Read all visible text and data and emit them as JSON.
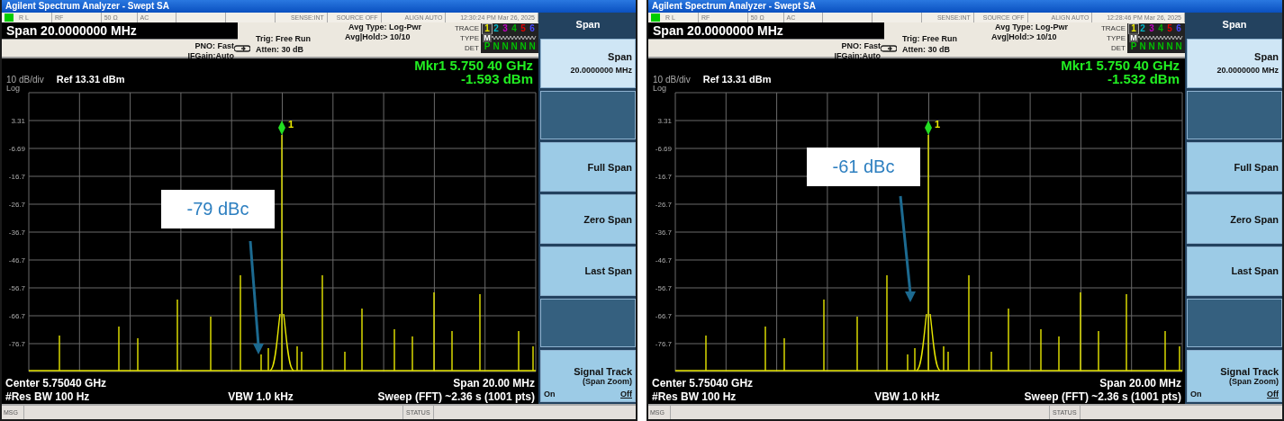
{
  "windows": [
    {
      "title": "Agilent Spectrum Analyzer - Swept SA",
      "status_items": [
        "R L",
        "RF",
        "50 Ω",
        "AC",
        "SENSE:INT",
        "SOURCE OFF",
        "ALIGN AUTO",
        "12:30:24 PM Mar 26, 2025"
      ],
      "active_function": "Span 20.0000000 MHz",
      "settings": {
        "pno": "PNO: Fast",
        "ifgain": "IFGain:Auto",
        "trig": "Trig: Free Run",
        "atten": "Atten: 30 dB",
        "avg_type": "Avg Type: Log-Pwr",
        "avg_hold": "Avg|Hold:> 10/10"
      },
      "trace_table": {
        "labels": [
          "TRACE",
          "TYPE",
          "DET"
        ],
        "traces": [
          {
            "number": "1",
            "color": "#e8e800",
            "selected": true,
            "type": "M",
            "det": "P"
          },
          {
            "number": "2",
            "color": "#00b8c8",
            "selected": false,
            "det": "N"
          },
          {
            "number": "3",
            "color": "#c000c0",
            "selected": false,
            "det": "N"
          },
          {
            "number": "4",
            "color": "#00b000",
            "selected": false,
            "det": "N"
          },
          {
            "number": "5",
            "color": "#e00000",
            "selected": false,
            "det": "N"
          },
          {
            "number": "6",
            "color": "#4848ff",
            "selected": false,
            "det": "N"
          }
        ]
      },
      "marker": {
        "frequency": "Mkr1 5.750 40 GHz",
        "amplitude": "-1.593 dBm",
        "label": "1"
      },
      "scale": "10 dB/div",
      "ref": "Ref 13.31 dBm",
      "scale_type": "Log",
      "y_labels": [
        "3.31",
        "-6.69",
        "-16.7",
        "-26.7",
        "-36.7",
        "-46.7",
        "-56.7",
        "-66.7",
        "-76.7"
      ],
      "annotation": "-79 dBc",
      "footer": {
        "center": "Center 5.75040 GHz",
        "span": "Span 20.00 MHz",
        "rbw": "#Res BW 100 Hz",
        "vbw": "VBW 1.0 kHz",
        "sweep": "Sweep (FFT)  ~2.36 s (1001 pts)"
      },
      "message_bar": {
        "msg": "MSG",
        "status": "STATUS"
      },
      "menu": {
        "title": "Span",
        "keys": [
          {
            "kind": "value",
            "label": "Span",
            "value": "20.0000000 MHz",
            "selected": true
          },
          {
            "kind": "empty"
          },
          {
            "kind": "plain",
            "label": "Full Span"
          },
          {
            "kind": "plain",
            "label": "Zero Span"
          },
          {
            "kind": "plain",
            "label": "Last Span"
          },
          {
            "kind": "empty"
          },
          {
            "kind": "toggle",
            "label": "Signal Track",
            "sublabel": "(Span Zoom)",
            "on_label": "On",
            "off_label": "Off",
            "on": false
          }
        ]
      }
    },
    {
      "title": "Agilent Spectrum Analyzer - Swept SA",
      "status_items": [
        "R L",
        "RF",
        "50 Ω",
        "AC",
        "SENSE:INT",
        "SOURCE OFF",
        "ALIGN AUTO",
        "12:28:46 PM Mar 26, 2025"
      ],
      "active_function": "Span 20.0000000 MHz",
      "settings": {
        "pno": "PNO: Fast",
        "ifgain": "IFGain:Auto",
        "trig": "Trig: Free Run",
        "atten": "Atten: 30 dB",
        "avg_type": "Avg Type: Log-Pwr",
        "avg_hold": "Avg|Hold:> 10/10"
      },
      "trace_table": {
        "labels": [
          "TRACE",
          "TYPE",
          "DET"
        ],
        "traces": [
          {
            "number": "1",
            "color": "#e8e800",
            "selected": true,
            "type": "M",
            "det": "P"
          },
          {
            "number": "2",
            "color": "#00b8c8",
            "selected": false,
            "det": "N"
          },
          {
            "number": "3",
            "color": "#c000c0",
            "selected": false,
            "det": "N"
          },
          {
            "number": "4",
            "color": "#00b000",
            "selected": false,
            "det": "N"
          },
          {
            "number": "5",
            "color": "#e00000",
            "selected": false,
            "det": "N"
          },
          {
            "number": "6",
            "color": "#4848ff",
            "selected": false,
            "det": "N"
          }
        ]
      },
      "marker": {
        "frequency": "Mkr1 5.750 40 GHz",
        "amplitude": "-1.532 dBm",
        "label": "1"
      },
      "scale": "10 dB/div",
      "ref": "Ref 13.31 dBm",
      "scale_type": "Log",
      "y_labels": [
        "3.31",
        "-6.69",
        "-16.7",
        "-26.7",
        "-36.7",
        "-46.7",
        "-56.7",
        "-66.7",
        "-76.7"
      ],
      "annotation": "-61 dBc",
      "footer": {
        "center": "Center 5.75040 GHz",
        "span": "Span 20.00 MHz",
        "rbw": "#Res BW 100 Hz",
        "vbw": "VBW 1.0 kHz",
        "sweep": "Sweep (FFT)  ~2.36 s (1001 pts)"
      },
      "message_bar": {
        "msg": "MSG",
        "status": "STATUS"
      },
      "menu": {
        "title": "Span",
        "keys": [
          {
            "kind": "value",
            "label": "Span",
            "value": "20.0000000 MHz",
            "selected": true
          },
          {
            "kind": "empty"
          },
          {
            "kind": "plain",
            "label": "Full Span"
          },
          {
            "kind": "plain",
            "label": "Zero Span"
          },
          {
            "kind": "plain",
            "label": "Last Span"
          },
          {
            "kind": "empty"
          },
          {
            "kind": "toggle",
            "label": "Signal Track",
            "sublabel": "(Span Zoom)",
            "on_label": "On",
            "off_label": "Off",
            "on": false
          }
        ]
      }
    }
  ]
}
